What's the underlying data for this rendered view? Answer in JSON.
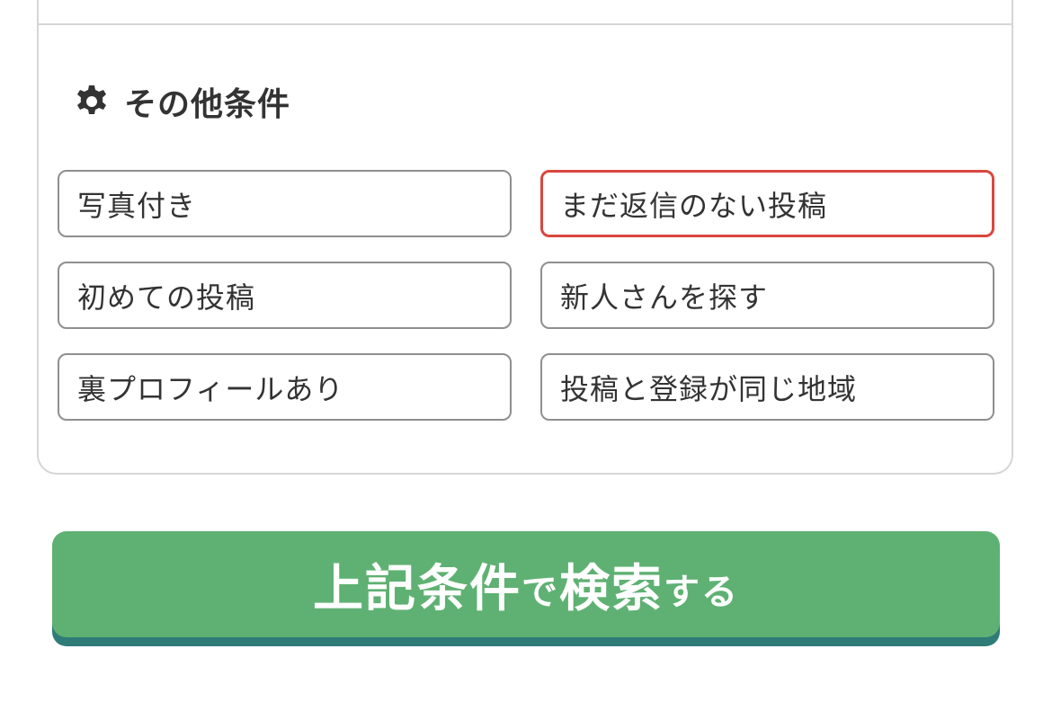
{
  "section": {
    "icon": "gear-icon",
    "title": "その他条件"
  },
  "options": [
    {
      "label": "写真付き",
      "selected": false
    },
    {
      "label": "まだ返信のない投稿",
      "selected": true
    },
    {
      "label": "初めての投稿",
      "selected": false
    },
    {
      "label": "新人さんを探す",
      "selected": false
    },
    {
      "label": "裏プロフィールあり",
      "selected": false
    },
    {
      "label": "投稿と登録が同じ地域",
      "selected": false
    }
  ],
  "search_button": {
    "part1": "上記条件",
    "part2": "で",
    "part3": "検索",
    "part4": "する"
  },
  "colors": {
    "selected_border": "#d9473f",
    "button_green": "#5fb173",
    "button_shadow": "#2f7b78"
  }
}
